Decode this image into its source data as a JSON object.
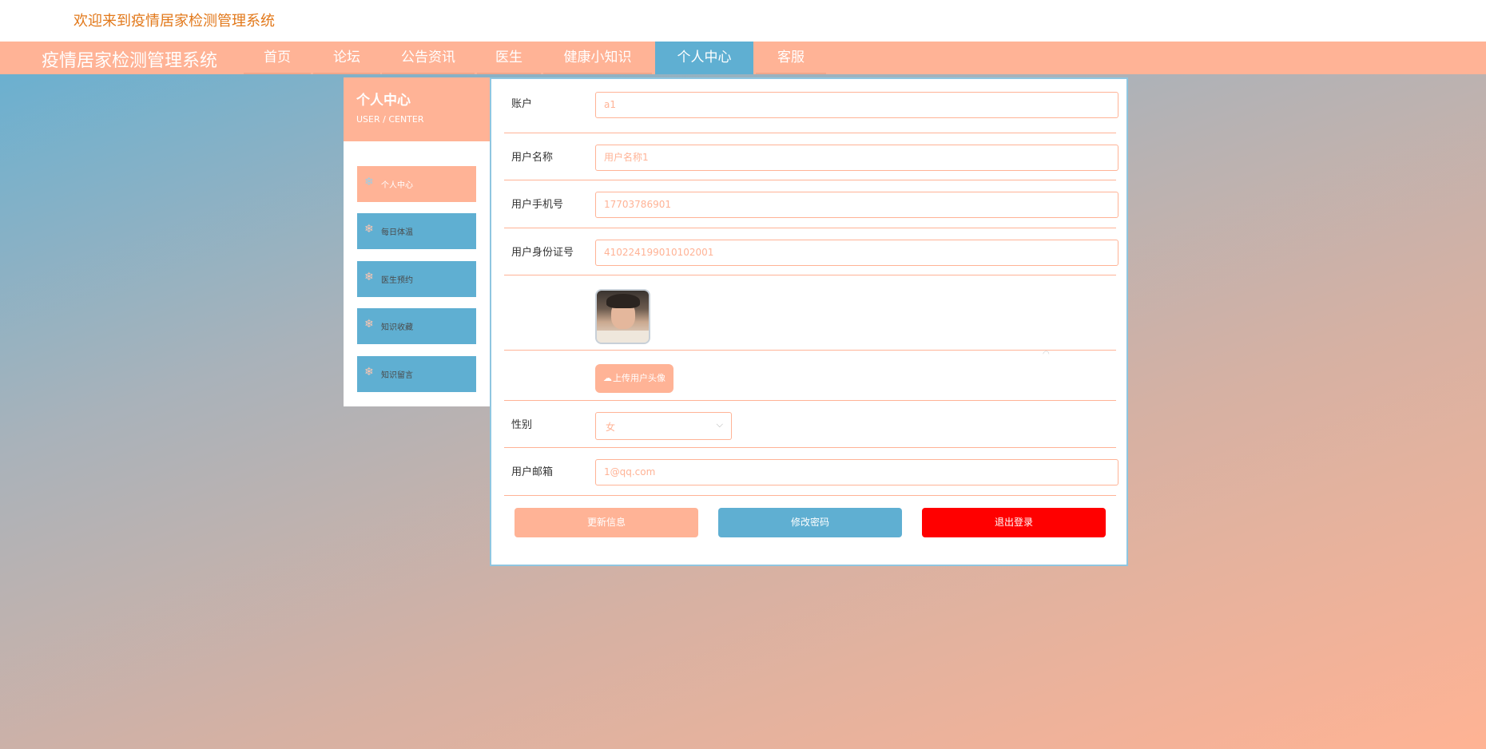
{
  "header": {
    "welcome": "欢迎来到疫情居家检测管理系统",
    "brand": "疫情居家检测管理系统"
  },
  "nav": {
    "items": [
      {
        "label": "首页"
      },
      {
        "label": "论坛"
      },
      {
        "label": "公告资讯"
      },
      {
        "label": "医生"
      },
      {
        "label": "健康小知识"
      },
      {
        "label": "个人中心"
      },
      {
        "label": "客服"
      }
    ],
    "active": "个人中心"
  },
  "sidebar": {
    "title": "个人中心",
    "subtitle": "USER / CENTER",
    "items": [
      {
        "label": "个人中心",
        "icon": "snowflake-icon"
      },
      {
        "label": "每日体温",
        "icon": "snowflake-icon"
      },
      {
        "label": "医生预约",
        "icon": "snowflake-icon"
      },
      {
        "label": "知识收藏",
        "icon": "snowflake-icon"
      },
      {
        "label": "知识留言",
        "icon": "snowflake-icon"
      }
    ]
  },
  "form": {
    "account": {
      "label": "账户",
      "value": "a1"
    },
    "username": {
      "label": "用户名称",
      "value": "用户名称1"
    },
    "phone": {
      "label": "用户手机号",
      "value": "17703786901"
    },
    "idcard": {
      "label": "用户身份证号",
      "value": "410224199010102001"
    },
    "upload_label": "上传用户头像",
    "gender": {
      "label": "性别",
      "value": "女"
    },
    "email": {
      "label": "用户邮箱",
      "value": "1@qq.com"
    }
  },
  "actions": {
    "update": "更新信息",
    "change_password": "修改密码",
    "logout": "退出登录"
  },
  "colors": {
    "primary": "#ffb396",
    "secondary": "#5fafd2",
    "danger": "#ff0000",
    "welcome_text": "#e2781a"
  }
}
